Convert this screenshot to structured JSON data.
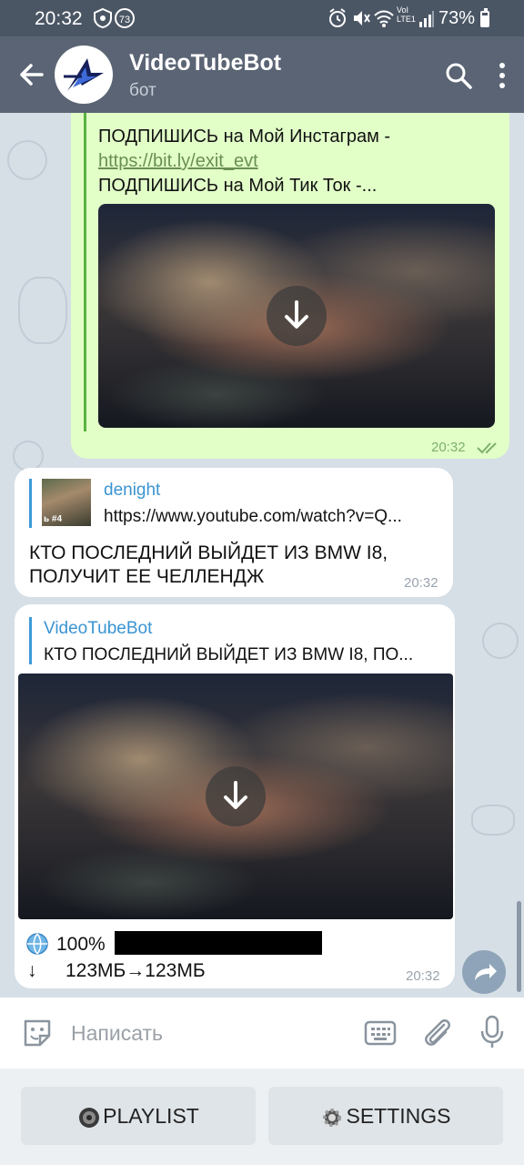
{
  "status_bar": {
    "time": "20:32",
    "notification_count": "73",
    "network_label": "VoI LTE1",
    "battery": "73%"
  },
  "header": {
    "title": "VideoTubeBot",
    "subtitle": "бот"
  },
  "messages": {
    "outgoing": {
      "line1": "ПОДПИШИСЬ на Мой Инстаграм -",
      "link": "https://bit.ly/exit_evt",
      "line3": "ПОДПИШИСЬ на Мой Тик Ток -...",
      "time": "20:32"
    },
    "incoming1": {
      "reply_name": "denight",
      "reply_text": "https://www.youtube.com/watch?v=Q...",
      "thumb_text": "ь #4",
      "text_line1": "КТО ПОСЛЕДНИЙ ВЫЙДЕТ ИЗ BMW I8,",
      "text_line2": "ПОЛУЧИТ ЕЕ ЧЕЛЛЕНДЖ",
      "time": "20:32"
    },
    "incoming2": {
      "reply_name": "VideoTubeBot",
      "reply_text": "КТО ПОСЛЕДНИЙ ВЫЙДЕТ ИЗ BMW I8, ПО...",
      "progress_text": "100%",
      "progress_value": 1.0,
      "size_arrow": "↓",
      "size_text": "123МБ→123МБ",
      "time": "20:32"
    }
  },
  "input": {
    "placeholder": "Написать"
  },
  "keyboard": {
    "playlist_label": "PLAYLIST",
    "settings_label": "SETTINGS"
  },
  "colors": {
    "header_bg": "#5a6474",
    "outgoing_bubble": "#e2ffc8",
    "link_accent": "#3a94d2"
  }
}
